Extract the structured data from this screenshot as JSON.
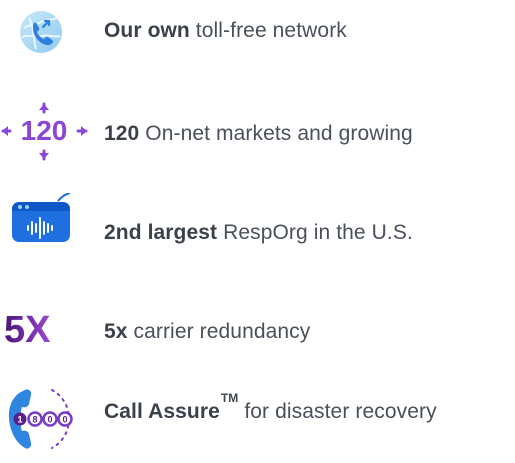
{
  "features": [
    {
      "icon": "phone-globe-icon",
      "bold": "Our own",
      "rest": " toll-free network"
    },
    {
      "icon": "expand-arrows-icon",
      "icon_text": "120",
      "bold": "120",
      "rest": " On-net markets and growing"
    },
    {
      "icon": "audio-window-icon",
      "bold": "2nd largest",
      "rest": " RespOrg in the U.S."
    },
    {
      "icon": "five-x-icon",
      "icon_text": "5X",
      "bold": "5x",
      "rest": " carrier redundancy"
    },
    {
      "icon": "phone-1800-icon",
      "icon_text": "1800",
      "bold": "Call Assure",
      "superscript": "TM",
      "rest": " for disaster recovery"
    }
  ],
  "colors": {
    "accent_blue": "#2f86e0",
    "light_blue": "#bfe3f6",
    "purple": "#5a1f8a",
    "violet": "#8b46d8",
    "text": "#3f4650"
  }
}
